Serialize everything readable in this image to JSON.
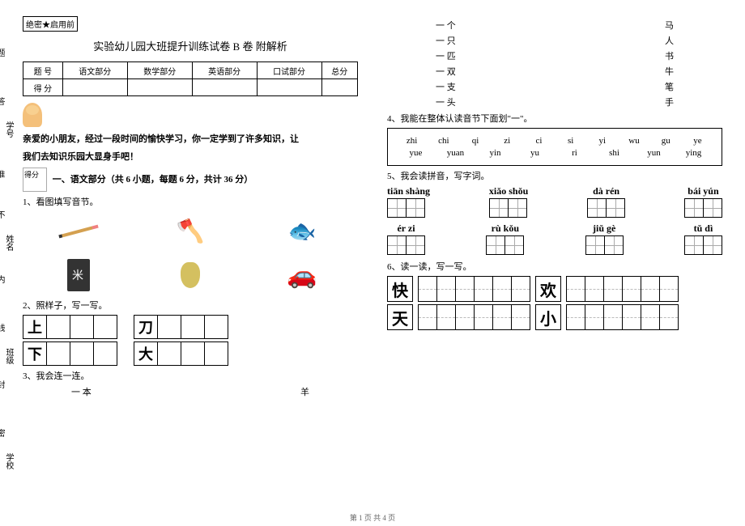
{
  "confidential": "绝密★启用前",
  "title": "实验幼儿园大班提升训练试卷 B 卷 附解析",
  "score_table": {
    "headers": [
      "题  号",
      "语文部分",
      "数学部分",
      "英语部分",
      "口试部分",
      "总分"
    ],
    "row_label": "得  分"
  },
  "intro_line1": "亲爱的小朋友，经过一段时间的愉快学习，你一定学到了许多知识，让",
  "intro_line2": "我们去知识乐园大显身手吧！",
  "score_box": "得分",
  "section1": "一、语文部分（共 6 小题，每题 6 分，共计 36 分）",
  "q1": "1、看图填写音节。",
  "q2": "2、照样子，写一写。",
  "trace_chars": [
    [
      "上",
      "刀"
    ],
    [
      "下",
      "大"
    ]
  ],
  "q3": "3、我会连一连。",
  "match_left": [
    "一  本",
    "一  个",
    "一  只",
    "一  匹",
    "一  双",
    "一  支",
    "一  头"
  ],
  "match_right": [
    "羊",
    "马",
    "人",
    "书",
    "牛",
    "笔",
    "手"
  ],
  "q4": "4、我能在整体认读音节下面划\"一\"。",
  "pinyin_rows": [
    [
      "zhi",
      "chi",
      "qi",
      "zi",
      "ci",
      "si",
      "yi",
      "wu",
      "gu",
      "ye"
    ],
    [
      "yue",
      "yuan",
      "yin",
      "yu",
      "ri",
      "shi",
      "yun",
      "ying"
    ]
  ],
  "q5": "5、我会读拼音，写字词。",
  "pinyin_write": [
    [
      {
        "py": "tiān shàng"
      },
      {
        "py": "xiǎo shǒu"
      },
      {
        "py": "dà  rén"
      },
      {
        "py": "bái  yún"
      }
    ],
    [
      {
        "py": "ér  zi"
      },
      {
        "py": "rù  kǒu"
      },
      {
        "py": "jiǔ  gè"
      },
      {
        "py": "tǔ  dì"
      }
    ]
  ],
  "q6": "6、读一读，写一写。",
  "write_chars": [
    [
      "快",
      "欢"
    ],
    [
      "天",
      "小"
    ]
  ],
  "margin_labels": [
    "学校",
    "班级",
    "姓名",
    "学号"
  ],
  "margin_marks": [
    "密",
    "封",
    "线",
    "内",
    "不",
    "准",
    "答",
    "题"
  ],
  "footer": "第 1 页 共 4 页"
}
